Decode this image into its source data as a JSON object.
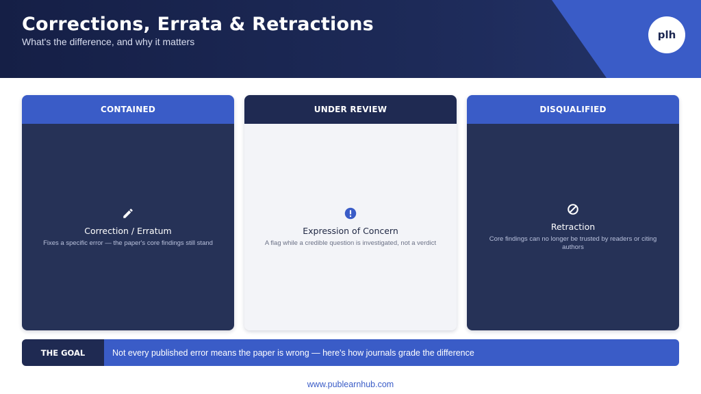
{
  "header": {
    "title": "Corrections, Errata & Retractions",
    "subtitle": "What's the difference, and why it matters",
    "logo_text": "plh"
  },
  "colors": {
    "navy": "#1f2a52",
    "blue": "#3a5cc7",
    "light": "#f3f4f8"
  },
  "cards": [
    {
      "heading": "CONTAINED",
      "icon": "pencil-icon",
      "title": "Correction / Erratum",
      "description": "Fixes a specific error — the paper's core findings still stand"
    },
    {
      "heading": "UNDER REVIEW",
      "icon": "exclamation-circle-icon",
      "title": "Expression of Concern",
      "description": "A flag while a credible question is investigated, not a verdict"
    },
    {
      "heading": "DISQUALIFIED",
      "icon": "prohibited-icon",
      "title": "Retraction",
      "description": "Core findings can no longer be trusted by readers or citing authors"
    }
  ],
  "goal": {
    "label": "THE GOAL",
    "text": "Not every published error means the paper is wrong — here's how journals grade the difference"
  },
  "footer": {
    "url": "www.publearnhub.com"
  }
}
